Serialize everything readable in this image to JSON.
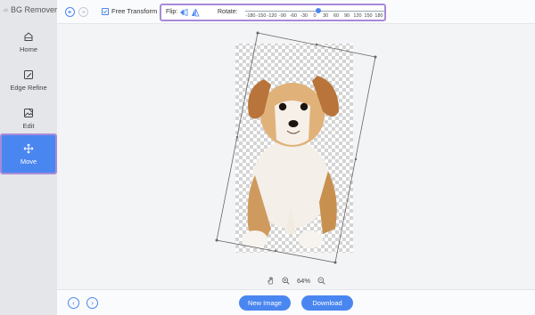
{
  "app": {
    "title": "BG Remover"
  },
  "sidebar": {
    "items": [
      {
        "label": "Home",
        "icon": "home-icon"
      },
      {
        "label": "Edge Refine",
        "icon": "edge-refine-icon"
      },
      {
        "label": "Edit",
        "icon": "edit-icon"
      },
      {
        "label": "Move",
        "icon": "move-icon",
        "active": true
      }
    ]
  },
  "toolbar": {
    "undo_icon": "undo-icon",
    "redo_icon": "redo-icon",
    "free_transform": {
      "label": "Free Transform",
      "checked": true
    },
    "flip_label": "Flip:",
    "rotate_label": "Rotate:",
    "rotate_ticks": [
      "-180",
      "-150",
      "-120",
      "-90",
      "-60",
      "-30",
      "0",
      "30",
      "60",
      "90",
      "120",
      "150",
      "180"
    ],
    "rotate_value": 0
  },
  "zoom": {
    "percent": "64%"
  },
  "bottom": {
    "new_image": "New Image",
    "download": "Download"
  },
  "colors": {
    "accent": "#4a86f0",
    "highlight": "#a78bd8"
  }
}
